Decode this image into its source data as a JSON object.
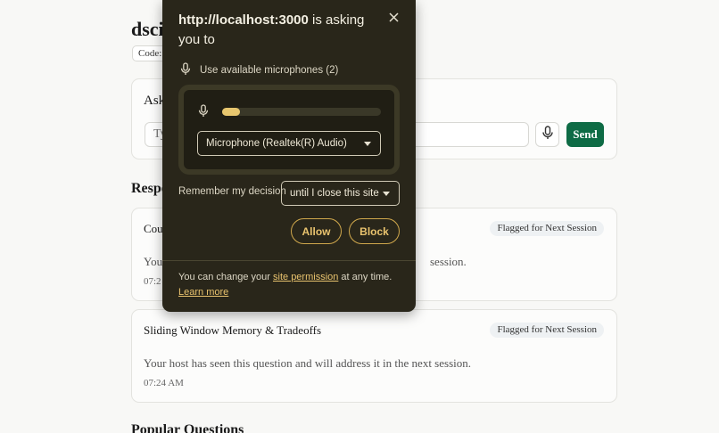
{
  "page": {
    "title": "dscis",
    "code_chip": "Code:",
    "ask_label": "Ask",
    "ask_input_placeholder": "Ty",
    "send_label": "Send",
    "responses_heading": "Respo",
    "popular_heading": "Popular Questions"
  },
  "responses": [
    {
      "title": "Cou",
      "badge": "Flagged for Next Session",
      "body_start": "Your",
      "body_end": "session.",
      "time": "07:2"
    },
    {
      "title": "Sliding Window Memory & Tradeoffs",
      "badge": "Flagged for Next Session",
      "body": "Your host has seen this question and will address it in the next session.",
      "time": "07:24 AM"
    }
  ],
  "popup": {
    "origin": "http://localhost:3000",
    "title_rest": " is asking you to",
    "permission": "Use available microphones (2)",
    "mic_level": 0.11,
    "selected_mic": "Microphone (Realtek(R) Audio)",
    "remember_label": "Remember my decision",
    "remember_value": "until I close this site",
    "allow_label": "Allow",
    "block_label": "Block",
    "footer_prefix": "You can change your ",
    "footer_link": "site permission",
    "footer_suffix": " at any time.",
    "learn_more": "Learn more"
  }
}
